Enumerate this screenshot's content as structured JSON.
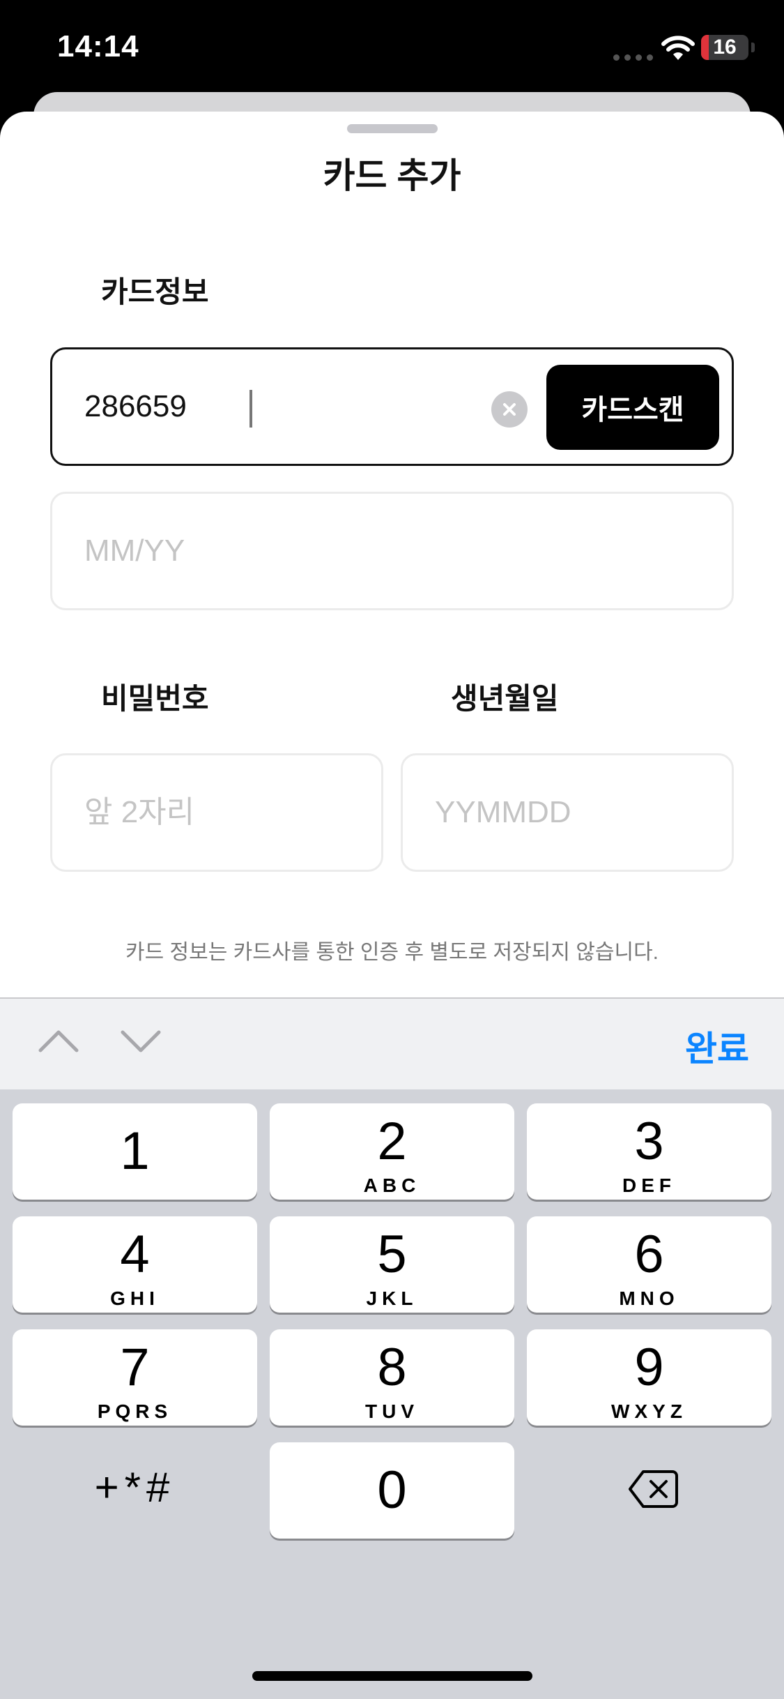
{
  "status_bar": {
    "time": "14:14",
    "battery_level": "16",
    "battery_fraction": 0.16
  },
  "sheet": {
    "title": "카드 추가"
  },
  "card_info": {
    "label": "카드정보",
    "card_number_value": "286659",
    "scan_label": "카드스캔",
    "expiry_placeholder": "MM/YY"
  },
  "password": {
    "label": "비밀번호",
    "placeholder": "앞 2자리"
  },
  "birthdate": {
    "label": "생년월일",
    "placeholder": "YYMMDD"
  },
  "notice": "카드 정보는 카드사를 통한 인증 후 별도로 저장되지 않습니다.",
  "accessory": {
    "done_label": "완료"
  },
  "keypad": {
    "keys": [
      {
        "digit": "1",
        "letters": ""
      },
      {
        "digit": "2",
        "letters": "ABC"
      },
      {
        "digit": "3",
        "letters": "DEF"
      },
      {
        "digit": "4",
        "letters": "GHI"
      },
      {
        "digit": "5",
        "letters": "JKL"
      },
      {
        "digit": "6",
        "letters": "MNO"
      },
      {
        "digit": "7",
        "letters": "PQRS"
      },
      {
        "digit": "8",
        "letters": "TUV"
      },
      {
        "digit": "9",
        "letters": "WXYZ"
      },
      {
        "digit": "0",
        "letters": ""
      }
    ],
    "symbols_label": "+*#"
  },
  "colors": {
    "accent": "#0a84ff",
    "battery_low": "#e0333b",
    "keypad_bg": "#d1d3d9"
  }
}
